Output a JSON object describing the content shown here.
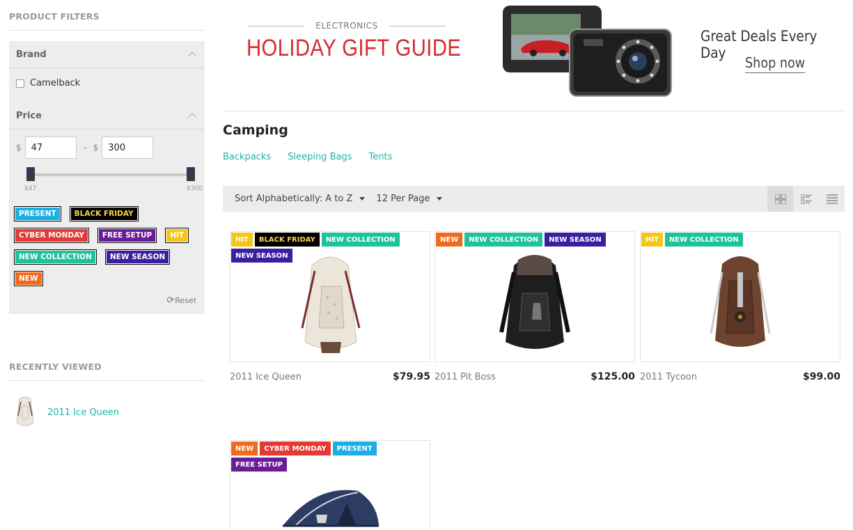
{
  "sidebar": {
    "filters_title": "PRODUCT FILTERS",
    "brand": {
      "label": "Brand",
      "options": [
        "Camelback"
      ]
    },
    "price": {
      "label": "Price",
      "currency": "$",
      "min": "47",
      "max": "300",
      "range_min_label": "$47",
      "range_max_label": "$300"
    },
    "tags": [
      {
        "label": "PRESENT",
        "color": "#1ab0e6"
      },
      {
        "label": "BLACK FRIDAY",
        "color": "#000000",
        "text_color": "#f5d547"
      },
      {
        "label": "CYBER MONDAY",
        "color": "#e53935"
      },
      {
        "label": "FREE SETUP",
        "color": "#6a1b9a"
      },
      {
        "label": "HIT",
        "color": "#f5c518"
      },
      {
        "label": "NEW COLLECTION",
        "color": "#1ec39a"
      },
      {
        "label": "NEW SEASON",
        "color": "#3b1fa0"
      },
      {
        "label": "NEW",
        "color": "#f26b1d"
      }
    ],
    "reset_label": "Reset",
    "recently_viewed_title": "RECENTLY VIEWED",
    "recently_viewed": [
      {
        "name": "2011 Ice Queen"
      }
    ]
  },
  "banner": {
    "eyebrow": "ELECTRONICS",
    "title": "HOLIDAY GIFT GUIDE",
    "tagline": "Great Deals Every Day",
    "cta": "Shop now"
  },
  "category": {
    "title": "Camping",
    "subcategories": [
      "Backpacks",
      "Sleeping Bags",
      "Tents"
    ]
  },
  "toolbar": {
    "sort_label": "Sort Alphabetically: A to Z",
    "per_page_label": "12 Per Page",
    "views": [
      "grid-view-icon",
      "list-grid-view-icon",
      "list-view-icon"
    ]
  },
  "products": [
    {
      "name": "2011 Ice Queen",
      "price": "$79.95",
      "badges": [
        {
          "label": "HIT",
          "color": "#f5c518"
        },
        {
          "label": "BLACK FRIDAY",
          "color": "#000000",
          "text_color": "#f5d547"
        },
        {
          "label": "NEW COLLECTION",
          "color": "#1ec39a"
        },
        {
          "label": "NEW SEASON",
          "color": "#3b1fa0"
        }
      ]
    },
    {
      "name": "2011 Pit Boss",
      "price": "$125.00",
      "badges": [
        {
          "label": "NEW",
          "color": "#f26b1d"
        },
        {
          "label": "NEW COLLECTION",
          "color": "#1ec39a"
        },
        {
          "label": "NEW SEASON",
          "color": "#3b1fa0"
        }
      ]
    },
    {
      "name": "2011 Tycoon",
      "price": "$99.00",
      "badges": [
        {
          "label": "HIT",
          "color": "#f5c518"
        },
        {
          "label": "NEW COLLECTION",
          "color": "#1ec39a"
        }
      ]
    },
    {
      "name": "",
      "price": "",
      "badges": [
        {
          "label": "NEW",
          "color": "#f26b1d"
        },
        {
          "label": "CYBER MONDAY",
          "color": "#e53935"
        },
        {
          "label": "PRESENT",
          "color": "#1ab0e6"
        },
        {
          "label": "FREE SETUP",
          "color": "#6a1b9a"
        }
      ]
    }
  ]
}
